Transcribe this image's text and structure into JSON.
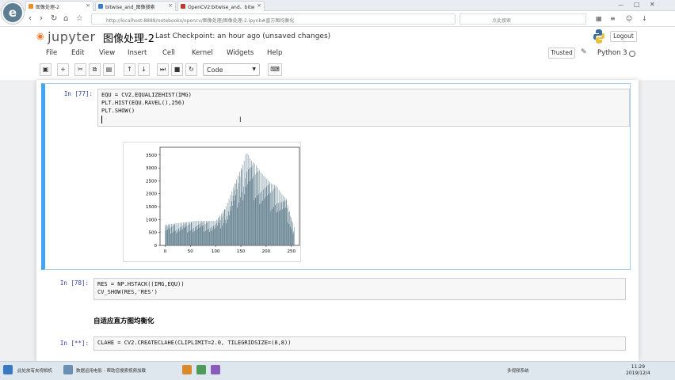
{
  "browser": {
    "tabs": [
      {
        "label": "图像处理-2",
        "color": "#f08c28",
        "active": true
      },
      {
        "label": "bitwise_and_图像搜索",
        "color": "#3a7bd5",
        "active": false
      },
      {
        "label": "OpenCV2:bitwise_and、bitw",
        "color": "#c0392b",
        "active": false
      }
    ],
    "url": "http://localhost:8888/notebooks/opencv/图像处理/图像处理-2.ipynb#直方图均衡化",
    "search_placeholder": "点此搜索"
  },
  "logo_letter": "e",
  "jupyter": {
    "brand": "jupyter",
    "notebook_title": "图像处理-2",
    "checkpoint": "Last Checkpoint: an hour ago (unsaved changes)",
    "logout": "Logout",
    "menus": [
      "File",
      "Edit",
      "View",
      "Insert",
      "Cell",
      "Kernel",
      "Widgets",
      "Help"
    ],
    "trusted": "Trusted",
    "kernel": "Python 3",
    "toolbar_icons": [
      "save-icon",
      "add-cell-icon",
      "cut-icon",
      "copy-icon",
      "paste-icon",
      "move-up-icon",
      "move-down-icon",
      "run-icon",
      "stop-icon",
      "restart-icon",
      "keyboard-icon"
    ],
    "cell_type": "Code"
  },
  "cells": [
    {
      "prompt": "In [77]:",
      "code": "EQU = CV2.EQUALIZEHIST(IMG)\nPLT.HIST(EQU.RAVEL(),256)\nPLT.SHOW()"
    },
    {
      "prompt": "In [78]:",
      "code": "RES = NP.HSTACK((IMG,EQU))\nCV_SHOW(RES,'RES')"
    },
    {
      "prompt": "In [**]:",
      "code": "CLAHE = CV2.CREATECLAHE(CLIPLIMIT=2.0, TILEGRIDSIZE=(8,8))"
    }
  ],
  "markdown_heading": "自适应直方图均衡化",
  "chart_data": {
    "type": "bar",
    "title": "",
    "xlabel": "",
    "ylabel": "",
    "xlim": [
      0,
      256
    ],
    "ylim": [
      0,
      3800
    ],
    "xticks": [
      0,
      50,
      100,
      150,
      200,
      250
    ],
    "yticks": [
      0,
      500,
      1000,
      1500,
      2000,
      2500,
      3000,
      3500
    ],
    "bar_color": "#5f7d8c",
    "envelope": {
      "x": [
        0,
        20,
        40,
        60,
        80,
        100,
        110,
        120,
        130,
        140,
        150,
        155,
        160,
        165,
        170,
        180,
        190,
        200,
        210,
        220,
        230,
        240,
        250,
        255
      ],
      "y": [
        800,
        850,
        900,
        950,
        950,
        950,
        1200,
        1500,
        2000,
        2500,
        3000,
        3200,
        3600,
        3500,
        3300,
        3100,
        2800,
        2600,
        2400,
        2300,
        2000,
        1800,
        1000,
        700
      ]
    }
  },
  "taskbar": {
    "items": [
      "此处放有夹视相机",
      "数据运用电影 - 帮助您搜索视频加载",
      "多视频系统"
    ],
    "time": "11:29",
    "date": "2019/12/4"
  }
}
